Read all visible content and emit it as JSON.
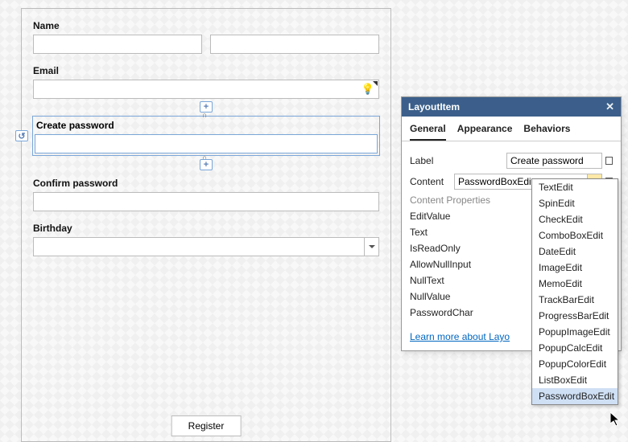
{
  "form": {
    "name_label": "Name",
    "first_name": "",
    "last_name": "",
    "email_label": "Email",
    "email_value": "",
    "create_pw_label": "Create password",
    "create_pw_value": "",
    "confirm_pw_label": "Confirm password",
    "confirm_pw_value": "",
    "birthday_label": "Birthday",
    "birthday_value": "",
    "register_button": "Register"
  },
  "panel": {
    "title": "LayoutItem",
    "tabs": {
      "general": "General",
      "appearance": "Appearance",
      "behaviors": "Behaviors"
    },
    "rows": {
      "label_label": "Label",
      "label_value": "Create password",
      "content_label": "Content",
      "content_value": "PasswordBoxEdit",
      "content_props_label": "Content Properties",
      "editvalue": "EditValue",
      "text": "Text",
      "isreadonly": "IsReadOnly",
      "allownullinput": "AllowNullInput",
      "nulltext": "NullText",
      "nullvalue": "NullValue",
      "passwordchar": "PasswordChar"
    },
    "learn_more": "Learn more about Layo"
  },
  "dropdown": {
    "options": [
      "TextEdit",
      "SpinEdit",
      "CheckEdit",
      "ComboBoxEdit",
      "DateEdit",
      "ImageEdit",
      "MemoEdit",
      "TrackBarEdit",
      "ProgressBarEdit",
      "PopupImageEdit",
      "PopupCalcEdit",
      "PopupColorEdit",
      "ListBoxEdit",
      "PasswordBoxEdit"
    ],
    "hover_index": 13
  }
}
